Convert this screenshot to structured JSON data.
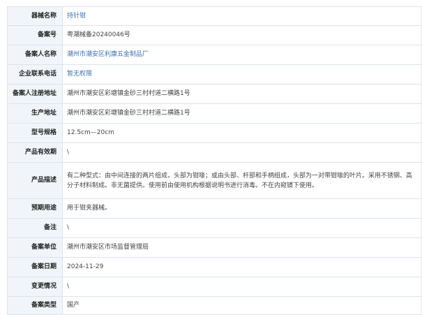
{
  "device_detail": {
    "rows": [
      {
        "label": "器械名称",
        "value": "持针钳"
      },
      {
        "label": "备案号",
        "value": "粤潮械备20240046号"
      },
      {
        "label": "备案人名称",
        "value": "潮州市潮安区利康五金制品厂"
      },
      {
        "label": "企业联系电话",
        "value": "暂无权限"
      },
      {
        "label": "备案人注册地址",
        "value": "潮州市潮安区彩塘镇金砂三村村道二横路1号"
      },
      {
        "label": "生产地址",
        "value": "潮州市潮安区彩塘镇金砂三村村道二横路1号"
      },
      {
        "label": "型号规格",
        "value": "12.5cm—20cm"
      },
      {
        "label": "产品有效期",
        "value": "\\"
      },
      {
        "label": "产品描述",
        "value": "有二种型式：由中间连接的两片组成，头部为钳喙；或由头部、杆部和手柄组成，头部为一对带钳喙的叶片。采用不锈钢、高分子材料制成。非无菌提供。使用前由使用机构根据说明书进行消毒。不在内窥镜下使用。"
      },
      {
        "label": "预期用途",
        "value": "用于钳夹器械。"
      },
      {
        "label": "备注",
        "value": "\\"
      },
      {
        "label": "备案单位",
        "value": "潮州市潮安区市场监督管理局"
      },
      {
        "label": "备案日期",
        "value": "2024-11-29"
      },
      {
        "label": "变更情况",
        "value": "\\"
      },
      {
        "label": "备案类型",
        "value": "国产"
      }
    ]
  },
  "colors": {
    "label_background": "#f1f5fa",
    "border": "#dce3ec",
    "link_text": "#3a6fb0"
  }
}
